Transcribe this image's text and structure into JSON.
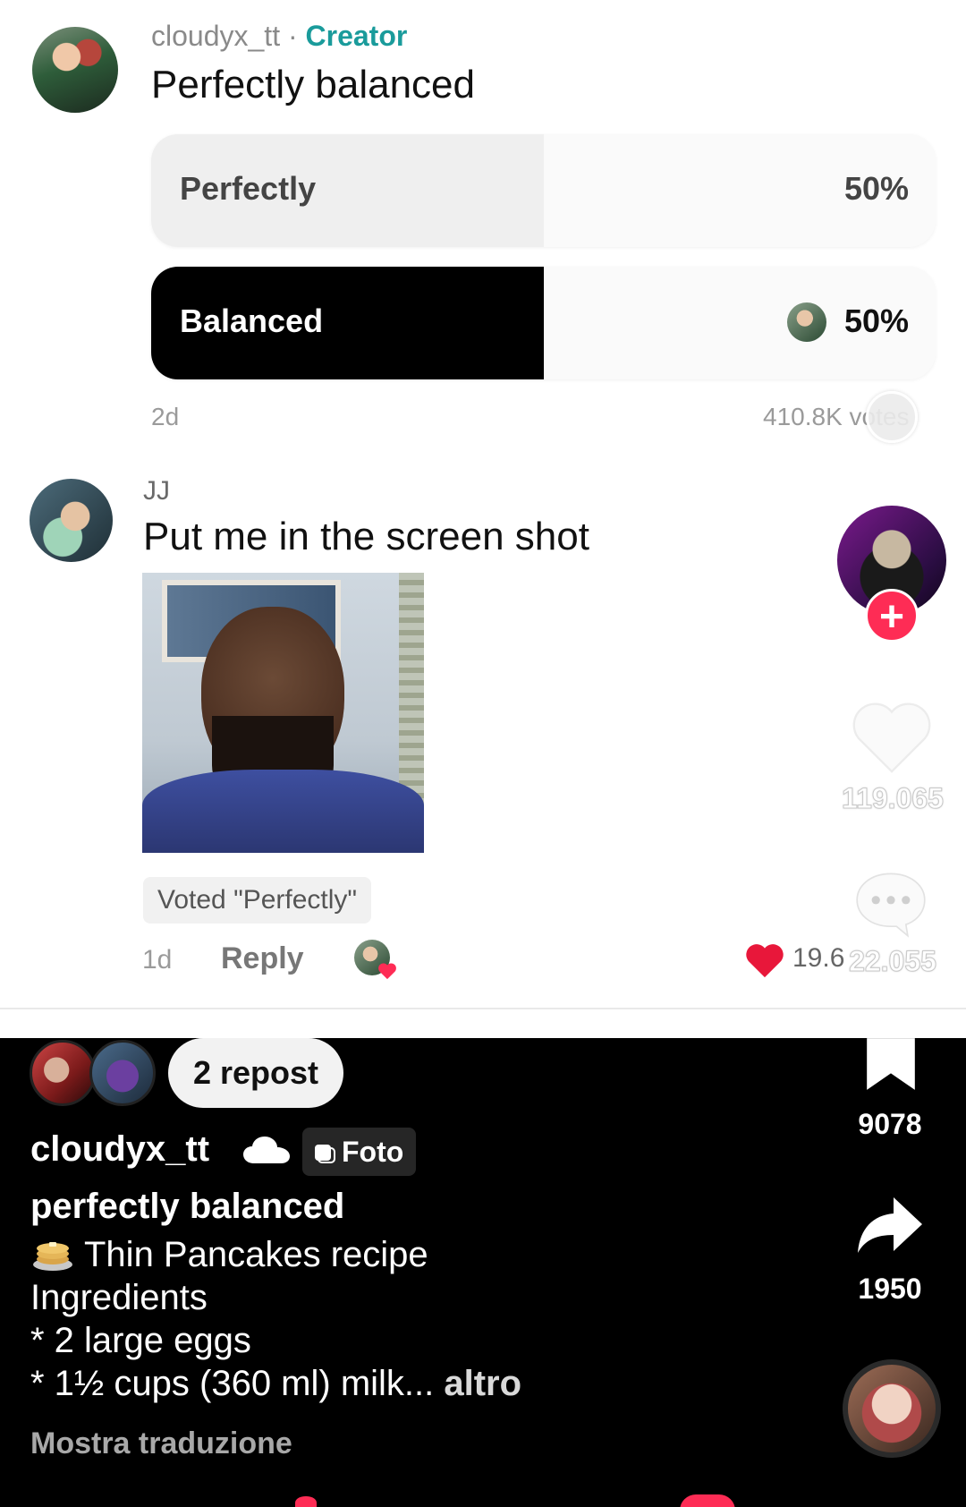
{
  "creator_comment": {
    "username": "cloudyx_tt",
    "role_label": "Creator",
    "separator": "·",
    "text": "Perfectly balanced"
  },
  "poll": {
    "options": [
      {
        "label": "Perfectly",
        "percent_label": "50%",
        "fill_fraction": 0.5
      },
      {
        "label": "Balanced",
        "percent_label": "50%",
        "fill_fraction": 0.5,
        "selected_by_creator": true
      }
    ],
    "age": "2d",
    "votes": "410.8K votes"
  },
  "reply_comment": {
    "username": "JJ",
    "text": "Put me in the screen shot",
    "voted_badge": "Voted \"Perfectly\"",
    "age": "1d",
    "reply_label": "Reply",
    "likes": "19.6"
  },
  "rail": {
    "likes": "119.065",
    "comments": "22.055",
    "saves": "9078",
    "shares": "1950",
    "follow_icon": "plus"
  },
  "post": {
    "repost_label": "2 repost",
    "author": "cloudyx_tt",
    "type_badge": "Foto",
    "title": "perfectly balanced",
    "caption_lines": [
      "Thin Pancakes recipe",
      "Ingredients",
      "* 2 large eggs",
      "* 1½ cups (360 ml) milk..."
    ],
    "more_label": "altro",
    "translate_label": "Mostra traduzione"
  },
  "colors": {
    "accent_red": "#fe2c55",
    "creator_teal": "#1a9b9b"
  }
}
